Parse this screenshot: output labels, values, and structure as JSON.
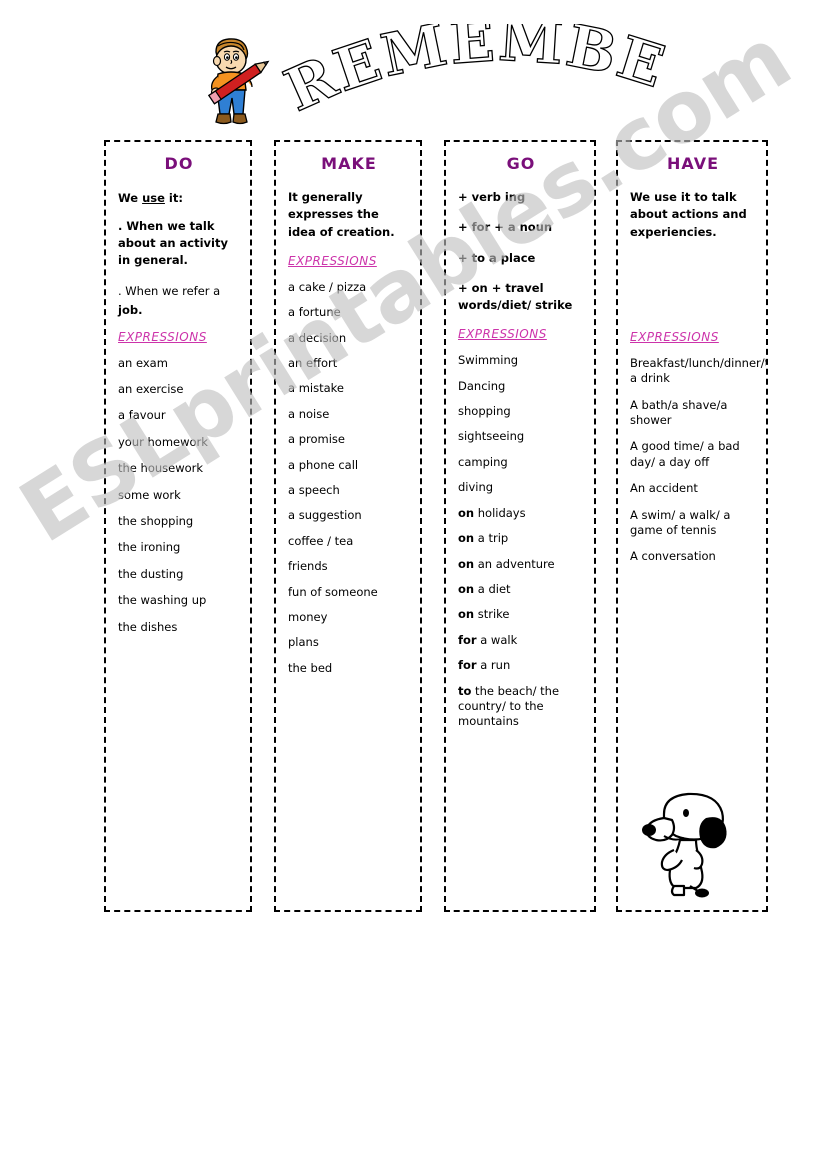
{
  "page": {
    "title": "REMEMBER!",
    "watermark": "ESLprintables.com",
    "title_color": "#ffffff",
    "header_color": "#7a0f7a",
    "expressions_color": "#cc33aa"
  },
  "illustrations": {
    "boy": "boy-with-pencil-clipart",
    "snoopy": "snoopy-clipart"
  },
  "columns": [
    {
      "id": "do",
      "title": "DO",
      "intro_bold_1": "We use it:",
      "intro_bold_1_underline": "use",
      "rule_1": ". When we talk about an activity in general.",
      "rule_2_light": ". When we refer a ",
      "rule_2_bold": "job.",
      "expressions_label": "EXPRESSIONS",
      "items": [
        "an exam",
        "an exercise",
        "a favour",
        "your homework",
        "the housework",
        "some work",
        "the shopping",
        "the ironing",
        "the dusting",
        "the washing up",
        "the dishes"
      ]
    },
    {
      "id": "make",
      "title": "MAKE",
      "rule_1": "It generally expresses the idea of creation.",
      "expressions_label": "EXPRESSIONS",
      "items": [
        "a cake / pizza",
        "a fortune",
        "a decision",
        "an effort",
        "a mistake",
        "a noise",
        "a promise",
        "a phone call",
        "a speech",
        "a suggestion",
        "coffee / tea",
        "friends",
        "fun of someone",
        "money",
        "plans",
        "the bed"
      ]
    },
    {
      "id": "go",
      "title": "GO",
      "rules": [
        "+ verb ing",
        "+ for + a noun",
        "+ to a place",
        "+  on + travel words/diet/ strike"
      ],
      "expressions_label": "EXPRESSIONS",
      "items": [
        {
          "bold": "",
          "rest": "Swimming"
        },
        {
          "bold": "",
          "rest": "Dancing"
        },
        {
          "bold": "",
          "rest": "shopping"
        },
        {
          "bold": "",
          "rest": "sightseeing"
        },
        {
          "bold": "",
          "rest": "camping"
        },
        {
          "bold": "",
          "rest": "diving"
        },
        {
          "bold": "on",
          "rest": " holidays"
        },
        {
          "bold": "on",
          "rest": " a trip"
        },
        {
          "bold": "on",
          "rest": " an adventure"
        },
        {
          "bold": "on",
          "rest": " a diet"
        },
        {
          "bold": "on",
          "rest": " strike"
        },
        {
          "bold": "for",
          "rest": " a walk"
        },
        {
          "bold": "for",
          "rest": " a run"
        },
        {
          "bold": "to",
          "rest": " the beach/ the country/ to the mountains"
        }
      ]
    },
    {
      "id": "have",
      "title": "HAVE",
      "rule_1": "We use it to talk about actions and experiencies.",
      "expressions_label": "EXPRESSIONS",
      "items": [
        "Breakfast/lunch/dinner/tea/coffee/ a drink",
        "A bath/a shave/a shower",
        "A good time/ a bad day/ a day off",
        "An accident",
        "A swim/ a walk/ a game of tennis",
        "A conversation"
      ]
    }
  ]
}
